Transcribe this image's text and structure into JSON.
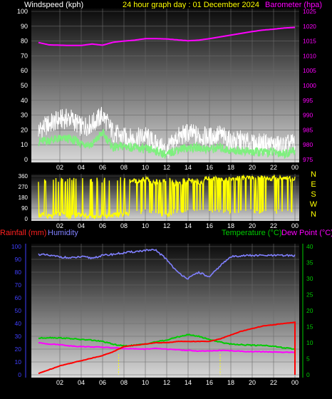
{
  "header": {
    "wind_label": "Windspeed (kph)",
    "title": "24 hour graph day : 01 December 2024",
    "baro_label": "Barometer (hpa)"
  },
  "footer_labels": {
    "rain": "Rainfall (mm)",
    "humidity": "Humidity",
    "temperature": "Temperature (°C)",
    "dewpoint": "Dew Point (°C)"
  },
  "colors": {
    "wind_gust": "#ffffff",
    "wind_avg": "#7ef07e",
    "barometer": "#ff00ff",
    "direction": "#ffff00",
    "rain": "#ff0000",
    "humidity": "#8080ff",
    "temperature": "#00cc00",
    "dewpoint": "#ff00ff",
    "left_axis_top": "#ffffff",
    "right_axis_top": "#ff00ff",
    "left_axis_bottom": "#4040ff",
    "right_axis_bottom": "#00cc00"
  },
  "chart_data": [
    {
      "type": "line",
      "x_ticks": [
        "02",
        "04",
        "06",
        "08",
        "10",
        "12",
        "14",
        "16",
        "18",
        "20",
        "22",
        "00"
      ],
      "y_left": {
        "label": "Windspeed (kph)",
        "ticks": [
          0,
          10,
          20,
          30,
          40,
          50,
          60,
          70,
          80,
          90,
          100
        ],
        "lim": [
          0,
          100
        ]
      },
      "y_right": {
        "label": "Barometer (hpa)",
        "ticks": [
          975,
          980,
          985,
          990,
          995,
          1000,
          1005,
          1010,
          1015,
          1020,
          1025
        ],
        "lim": [
          975,
          1025
        ]
      },
      "x_hours": [
        0,
        1,
        2,
        3,
        4,
        5,
        6,
        7,
        8,
        9,
        10,
        11,
        12,
        13,
        14,
        15,
        16,
        17,
        18,
        19,
        20,
        21,
        22,
        23,
        24
      ],
      "series": [
        {
          "name": "Windspeed (kph)",
          "axis": "left",
          "values": [
            20,
            24,
            27,
            28,
            22,
            24,
            30,
            18,
            15,
            14,
            16,
            10,
            6,
            15,
            18,
            16,
            15,
            17,
            12,
            13,
            10,
            11,
            10,
            9,
            12
          ]
        },
        {
          "name": "",
          "axis": "left",
          "values": [
            12,
            13,
            14,
            14,
            11,
            10,
            18,
            8,
            9,
            8,
            7,
            6,
            3,
            7,
            8,
            8,
            7,
            8,
            6,
            6,
            5,
            5,
            5,
            4,
            6
          ]
        },
        {
          "name": "Barometer (hpa)",
          "axis": "right",
          "values": [
            1014.5,
            1013.7,
            1013.6,
            1013.5,
            1013.5,
            1014.0,
            1013.6,
            1014.6,
            1015.0,
            1015.3,
            1015.8,
            1015.8,
            1015.7,
            1015.4,
            1015.1,
            1015.3,
            1015.8,
            1016.4,
            1017.0,
            1017.6,
            1018.2,
            1018.7,
            1019.0,
            1019.4,
            1019.6
          ]
        }
      ]
    },
    {
      "type": "scatter",
      "x_ticks": [
        "02",
        "04",
        "06",
        "08",
        "10",
        "12",
        "14",
        "16",
        "18",
        "20",
        "22",
        "00"
      ],
      "y_left": {
        "ticks": [
          0,
          90,
          180,
          270,
          360
        ],
        "lim": [
          0,
          360
        ]
      },
      "y_right": {
        "ticks": [
          "N",
          "W",
          "S",
          "E",
          "N"
        ]
      },
      "x_hours": [
        0,
        1,
        2,
        3,
        4,
        5,
        6,
        7,
        8,
        9,
        10,
        11,
        12,
        13,
        14,
        15,
        16,
        17,
        18,
        19,
        20,
        21,
        22,
        23,
        24
      ],
      "series": [
        {
          "name": "",
          "values": [
            30,
            20,
            40,
            25,
            30,
            20,
            25,
            30,
            40,
            320,
            330,
            310,
            30,
            300,
            320,
            310,
            340,
            335,
            340,
            345,
            340,
            345,
            340,
            345,
            340
          ]
        }
      ]
    },
    {
      "type": "line",
      "x_ticks": [
        "02",
        "04",
        "06",
        "08",
        "10",
        "12",
        "14",
        "16",
        "18",
        "20",
        "22",
        "00"
      ],
      "y_left": {
        "label": "Rainfall (mm)",
        "ticks": [
          0,
          10,
          20,
          30,
          40,
          50,
          60,
          70,
          80,
          90,
          100
        ],
        "lim": [
          0,
          100
        ]
      },
      "y_right": {
        "label": "Temperature (°C)",
        "ticks": [
          0,
          5,
          10,
          15,
          20,
          25,
          30,
          35,
          40
        ],
        "lim": [
          0,
          40
        ]
      },
      "x_hours": [
        0,
        1,
        2,
        3,
        4,
        5,
        6,
        7,
        8,
        9,
        10,
        11,
        12,
        13,
        14,
        15,
        16,
        17,
        18,
        19,
        20,
        21,
        22,
        23,
        24
      ],
      "series": [
        {
          "name": "Rainfall (mm)",
          "axis": "left",
          "values": [
            1,
            4,
            7,
            9,
            11,
            13,
            15,
            18,
            22,
            23,
            24,
            25,
            25,
            26,
            26,
            26,
            26,
            28,
            31,
            34,
            36,
            38,
            39,
            40,
            41
          ]
        },
        {
          "name": "Humidity",
          "axis": "left",
          "values": [
            94,
            93,
            92,
            91,
            92,
            91,
            93,
            94,
            95,
            96,
            97,
            97,
            90,
            80,
            75,
            80,
            76,
            85,
            92,
            93,
            93,
            93,
            93,
            93,
            93
          ]
        },
        {
          "name": "Temperature (°C)",
          "axis": "right",
          "values": [
            11.4,
            11.6,
            11.5,
            11.3,
            11.0,
            10.8,
            10.4,
            9.5,
            9.0,
            9.2,
            9.6,
            10.3,
            10.8,
            11.8,
            12.5,
            12.0,
            11.0,
            10.2,
            9.6,
            9.4,
            9.2,
            9.2,
            8.9,
            8.4,
            8.0
          ]
        },
        {
          "name": "Dew Point (°C)",
          "axis": "right",
          "values": [
            10.0,
            9.6,
            9.4,
            9.0,
            8.8,
            8.7,
            8.6,
            8.4,
            8.2,
            8.1,
            8.0,
            8.2,
            8.0,
            7.8,
            7.6,
            7.4,
            7.4,
            7.6,
            7.5,
            7.3,
            7.2,
            7.2,
            7.1,
            7.0,
            7.0
          ]
        }
      ],
      "markers_hours": [
        7.5,
        17
      ]
    }
  ]
}
